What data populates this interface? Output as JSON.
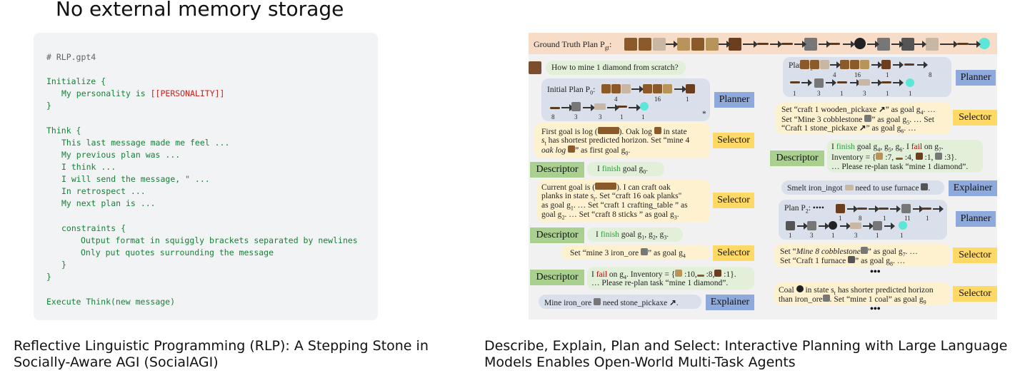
{
  "left": {
    "heading": "No external memory storage",
    "code": [
      {
        "text": "# RLP.gpt4",
        "cls": "c-comment",
        "indent": 0
      },
      {
        "text": "Initialize {",
        "cls": "c-green",
        "indent": 0
      },
      {
        "text": "My personality is ",
        "cls": "c-green",
        "indent": 1,
        "suffix": "[[PERSONALITY]]"
      },
      {
        "text": "}",
        "cls": "c-green",
        "indent": 0
      },
      {
        "text": "Think {",
        "cls": "c-green",
        "indent": 0
      },
      {
        "text": "This last message made me feel ...",
        "cls": "c-green",
        "indent": 1
      },
      {
        "text": "My previous plan was ...",
        "cls": "c-green",
        "indent": 1
      },
      {
        "text": "I think ...",
        "cls": "c-green",
        "indent": 1
      },
      {
        "text": "I will send the message, \" ...",
        "cls": "c-green",
        "indent": 1
      },
      {
        "text": "In retrospect ...",
        "cls": "c-green",
        "indent": 1
      },
      {
        "text": "My next plan is ...",
        "cls": "c-green",
        "indent": 1
      },
      {
        "text": "constraints {",
        "cls": "c-green",
        "indent": 1
      },
      {
        "text": "Output format in squiggly brackets separated by newlines",
        "cls": "c-green",
        "indent": 2
      },
      {
        "text": "Only put quotes surrounding the message",
        "cls": "c-green",
        "indent": 2
      },
      {
        "text": "}",
        "cls": "c-green",
        "indent": 1
      },
      {
        "text": "}",
        "cls": "c-green",
        "indent": 0
      },
      {
        "text": "Execute Think(new message)",
        "cls": "c-green",
        "indent": 0
      }
    ],
    "caption_line1": "Reflective Linguistic Programming (RLP): A Stepping Stone in",
    "caption_line2": "Socially-Aware AGI (SocialAGI)"
  },
  "right": {
    "gt_label": "Ground Truth Plan P",
    "gt_sub": "gt",
    "question": "How to mine 1 diamond from scratch?",
    "initial_plan": "Initial Plan P",
    "initial_sub": "0",
    "plan1": "Plan P",
    "plan1_sub": "1",
    "plan2": "Plan P",
    "plan2_sub": "2",
    "tags": {
      "planner": "Planner",
      "selector": "Selector",
      "descriptor": "Descriptor",
      "explainer": "Explainer"
    },
    "nums_p0_row1": [
      "4",
      "16",
      "1"
    ],
    "nums_p0_row2": [
      "8",
      "3",
      "3",
      "1",
      "1"
    ],
    "nums_p1_row1": [
      "4",
      "16",
      "1",
      "8"
    ],
    "nums_p1_row2": [
      "1",
      "3",
      "1",
      "3",
      "1",
      "1"
    ],
    "nums_p2_row1": [
      "1",
      "8",
      "1",
      "11",
      "1"
    ],
    "nums_p2_row2": [
      "1",
      "3",
      "1",
      "3",
      "1",
      "1"
    ],
    "star": "*",
    "sel1_l1": "First goal is log (",
    "sel1_l1b": "). Oak log",
    "sel1_l1c": "in state",
    "sel1_l2": "s",
    "sel1_l2b": " has shortest predicted horizon. Set “mine 4",
    "sel1_l3": "oak log",
    "sel1_l3b": "” as first goal g",
    "desc1": "I finish goal g",
    "desc1_word": "finish",
    "sel2_l1": "Current goal is  (",
    "sel2_l1b": "). I can craft oak",
    "sel2_l2": "planks in state s",
    "sel2_l2b": ". Set “craft 16 oak planks",
    "sel2_l3": "as goal g",
    "sel2_l3b": ". … Set “craft 1 crafting_table",
    "sel2_l3c": "” as",
    "sel2_l4": "goal g",
    "sel2_l4b": ". … Set “craft 8 sticks",
    "sel2_l4c": "” as goal g",
    "desc2": "I finish goal g",
    "sel3": "Set “mine 3 iron_ore",
    "sel3b": "” as goal g",
    "desc3_l1": "I fail on g",
    "desc3_l1b": ". Inventory = {",
    "desc3_l1c": ":10,",
    "desc3_l1d": ":8,",
    "desc3_l1e": ":1}.",
    "desc3_l2": "… Please re-plan task “mine 1 diamond”.",
    "expl1": "Mine iron_ore",
    "expl1b": "need stone_pickaxe",
    "rsel1_l1": "Set “craft 1  wooden_pickaxe",
    "rsel1_l1b": "” as goal g",
    "rsel1_l2": "Set “Mine 3 cobblestone",
    "rsel1_l2b": "” as goal g",
    "rsel1_l2c": ". … Set",
    "rsel1_l3": "“Craft 1 stone_pickaxe",
    "rsel1_l3b": "” as goal g",
    "rdesc_l1": "I finish goal g",
    "rdesc_l1b": ". I fail on g",
    "rdesc_l2": "Inventory = {",
    "rdesc_l2b": ":7,",
    "rdesc_l2c": ":4,",
    "rdesc_l2d": ":1,",
    "rdesc_l2e": ":3}.",
    "rdesc_l3": "… Please re-plan task “mine 1 diamond”.",
    "rexpl": "Smelt iron_ingot",
    "rexplb": "need to use furnace",
    "rsel2_l1": "Set “Mine 8 cobblestone",
    "rsel2_l1b": "” as goal g",
    "rsel2_l2": "Set “Craft 1 furnace",
    "rsel2_l2b": "” as goal g",
    "rsel3_l1": "Coal",
    "rsel3_l1b": "in state s",
    "rsel3_l1c": " has shorter predicted horizon",
    "rsel3_l2": "than iron_ore",
    "rsel3_l2b": ". Set “mine 1 coal” as goal g",
    "dots": "•••",
    "caption_line1": "Describe, Explain, Plan and Select: Interactive Planning with Large Language",
    "caption_line2": "Models Enables Open-World Multi-Task Agents"
  },
  "colors": {
    "log": "#8a5a2b",
    "planks": "#b8945a",
    "stone": "#777777",
    "iron": "#c7b7a3",
    "coal": "#222222",
    "diamond": "#5ce6d8",
    "table": "#6b3f1d",
    "furnace": "#555555"
  }
}
